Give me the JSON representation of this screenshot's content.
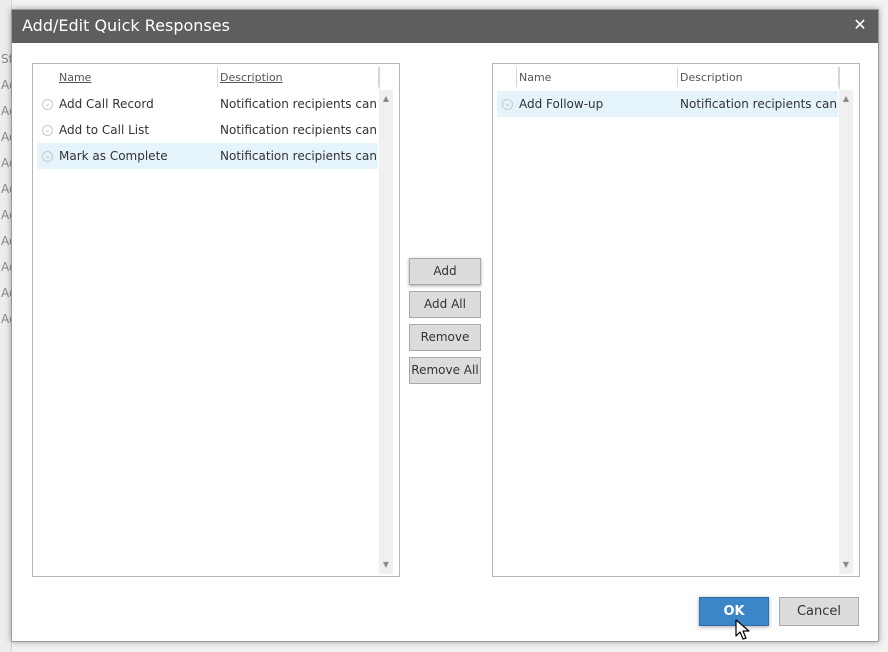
{
  "dialog": {
    "title": "Add/Edit Quick Responses",
    "close_icon": "close-icon"
  },
  "background": {
    "letters": [
      "St",
      "Ad",
      "Ad",
      "Ad",
      "Ad",
      "Ad",
      "Ad",
      "Ad",
      "Ad",
      "Ad",
      "Ad"
    ]
  },
  "available": {
    "columns": [
      "Name",
      "Description"
    ],
    "rows": [
      {
        "name": "Add Call Record",
        "description": "Notification recipients can ...",
        "selected": false
      },
      {
        "name": "Add to Call List",
        "description": "Notification recipients can ...",
        "selected": false
      },
      {
        "name": "Mark as Complete",
        "description": "Notification recipients can ...",
        "selected": true
      }
    ]
  },
  "selected": {
    "columns": [
      "Name",
      "Description"
    ],
    "rows": [
      {
        "name": "Add Follow-up",
        "description": "Notification recipients can ...",
        "selected": true
      }
    ]
  },
  "actions": {
    "add": "Add",
    "add_all": "Add All",
    "remove": "Remove",
    "remove_all": "Remove All"
  },
  "footer": {
    "ok": "OK",
    "cancel": "Cancel"
  },
  "colors": {
    "titlebar": "#5e5e5e",
    "selected_row": "#e5f3fb",
    "ok_button": "#3b86c8"
  }
}
